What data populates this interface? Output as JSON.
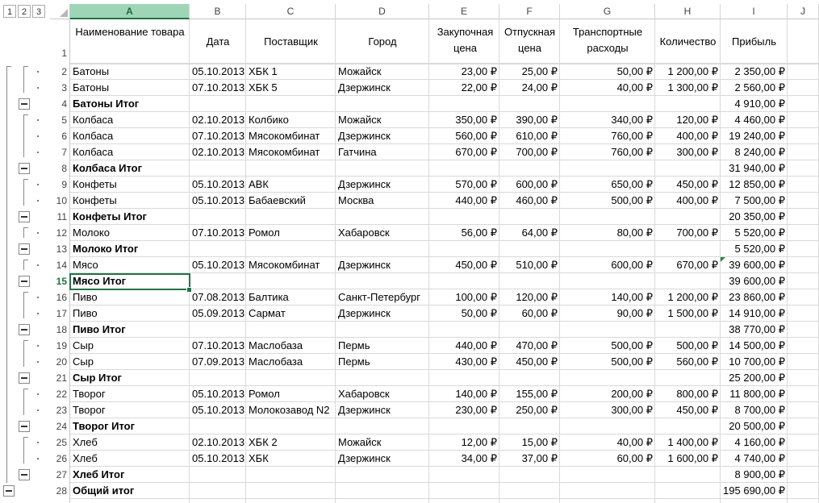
{
  "outline_levels": [
    "1",
    "2",
    "3"
  ],
  "columns": [
    "A",
    "B",
    "C",
    "D",
    "E",
    "F",
    "G",
    "H",
    "I",
    "J"
  ],
  "headers": {
    "name": "Наименование товара",
    "date": "Дата",
    "supplier": "Поставщик",
    "city": "Город",
    "buy_price": "Закупочная цена",
    "sell_price": "Отпускная цена",
    "transport": "Транспортные расходы",
    "qty": "Количество",
    "profit": "Прибыль"
  },
  "rows": [
    {
      "n": "2",
      "name": "Батоны",
      "date": "05.10.2013",
      "supplier": "ХБК 1",
      "city": "Можайск",
      "buy": "23,00 ₽",
      "sell": "25,00 ₽",
      "trans": "50,00 ₽",
      "qty": "1 200,00 ₽",
      "profit": "2 350,00 ₽",
      "type": "detail"
    },
    {
      "n": "3",
      "name": "Батоны",
      "date": "07.10.2013",
      "supplier": "ХБК 5",
      "city": "Дзержинск",
      "buy": "22,00 ₽",
      "sell": "24,00 ₽",
      "trans": "40,00 ₽",
      "qty": "1 300,00 ₽",
      "profit": "2 560,00 ₽",
      "type": "detail"
    },
    {
      "n": "4",
      "name": "Батоны Итог",
      "date": "",
      "supplier": "",
      "city": "",
      "buy": "",
      "sell": "",
      "trans": "",
      "qty": "",
      "profit": "4 910,00 ₽",
      "type": "subtotal"
    },
    {
      "n": "5",
      "name": "Колбаса",
      "date": "02.10.2013",
      "supplier": "Колбико",
      "city": "Можайск",
      "buy": "350,00 ₽",
      "sell": "390,00 ₽",
      "trans": "340,00 ₽",
      "qty": "120,00 ₽",
      "profit": "4 460,00 ₽",
      "type": "detail"
    },
    {
      "n": "6",
      "name": "Колбаса",
      "date": "07.10.2013",
      "supplier": "Мясокомбинат",
      "city": "Дзержинск",
      "buy": "560,00 ₽",
      "sell": "610,00 ₽",
      "trans": "760,00 ₽",
      "qty": "400,00 ₽",
      "profit": "19 240,00 ₽",
      "type": "detail"
    },
    {
      "n": "7",
      "name": "Колбаса",
      "date": "02.10.2013",
      "supplier": "Мясокомбинат",
      "city": "Гатчина",
      "buy": "670,00 ₽",
      "sell": "700,00 ₽",
      "trans": "760,00 ₽",
      "qty": "300,00 ₽",
      "profit": "8 240,00 ₽",
      "type": "detail"
    },
    {
      "n": "8",
      "name": "Колбаса Итог",
      "date": "",
      "supplier": "",
      "city": "",
      "buy": "",
      "sell": "",
      "trans": "",
      "qty": "",
      "profit": "31 940,00 ₽",
      "type": "subtotal"
    },
    {
      "n": "9",
      "name": "Конфеты",
      "date": "05.10.2013",
      "supplier": "АВК",
      "city": "Дзержинск",
      "buy": "570,00 ₽",
      "sell": "600,00 ₽",
      "trans": "650,00 ₽",
      "qty": "450,00 ₽",
      "profit": "12 850,00 ₽",
      "type": "detail"
    },
    {
      "n": "10",
      "name": "Конфеты",
      "date": "05.10.2013",
      "supplier": "Бабаевский",
      "city": "Москва",
      "buy": "440,00 ₽",
      "sell": "460,00 ₽",
      "trans": "500,00 ₽",
      "qty": "400,00 ₽",
      "profit": "7 500,00 ₽",
      "type": "detail"
    },
    {
      "n": "11",
      "name": "Конфеты  Итог",
      "date": "",
      "supplier": "",
      "city": "",
      "buy": "",
      "sell": "",
      "trans": "",
      "qty": "",
      "profit": "20 350,00 ₽",
      "type": "subtotal"
    },
    {
      "n": "12",
      "name": "Молоко",
      "date": "07.10.2013",
      "supplier": "Ромол",
      "city": "Хабаровск",
      "buy": "56,00 ₽",
      "sell": "64,00 ₽",
      "trans": "80,00 ₽",
      "qty": "700,00 ₽",
      "profit": "5 520,00 ₽",
      "type": "detail"
    },
    {
      "n": "13",
      "name": "Молоко Итог",
      "date": "",
      "supplier": "",
      "city": "",
      "buy": "",
      "sell": "",
      "trans": "",
      "qty": "",
      "profit": "5 520,00 ₽",
      "type": "subtotal"
    },
    {
      "n": "14",
      "name": "Мясо",
      "date": "05.10.2013",
      "supplier": "Мясокомбинат",
      "city": "Дзержинск",
      "buy": "450,00 ₽",
      "sell": "510,00 ₽",
      "trans": "600,00 ₽",
      "qty": "670,00 ₽",
      "profit": "39 600,00 ₽",
      "type": "detail"
    },
    {
      "n": "15",
      "name": "Мясо Итог",
      "date": "",
      "supplier": "",
      "city": "",
      "buy": "",
      "sell": "",
      "trans": "",
      "qty": "",
      "profit": "39 600,00 ₽",
      "type": "subtotal"
    },
    {
      "n": "16",
      "name": "Пиво",
      "date": "07.08.2013",
      "supplier": "Балтика",
      "city": "Санкт-Петербург",
      "buy": "100,00 ₽",
      "sell": "120,00 ₽",
      "trans": "140,00 ₽",
      "qty": "1 200,00 ₽",
      "profit": "23 860,00 ₽",
      "type": "detail"
    },
    {
      "n": "17",
      "name": "Пиво",
      "date": "05.09.2013",
      "supplier": "Сармат",
      "city": "Дзержинск",
      "buy": "50,00 ₽",
      "sell": "60,00 ₽",
      "trans": "90,00 ₽",
      "qty": "1 500,00 ₽",
      "profit": "14 910,00 ₽",
      "type": "detail"
    },
    {
      "n": "18",
      "name": "Пиво Итог",
      "date": "",
      "supplier": "",
      "city": "",
      "buy": "",
      "sell": "",
      "trans": "",
      "qty": "",
      "profit": "38 770,00 ₽",
      "type": "subtotal"
    },
    {
      "n": "19",
      "name": "Сыр",
      "date": "07.10.2013",
      "supplier": "Маслобаза",
      "city": "Пермь",
      "buy": "440,00 ₽",
      "sell": "470,00 ₽",
      "trans": "500,00 ₽",
      "qty": "500,00 ₽",
      "profit": "14 500,00 ₽",
      "type": "detail"
    },
    {
      "n": "20",
      "name": "Сыр",
      "date": "07.09.2013",
      "supplier": "Маслобаза",
      "city": "Пермь",
      "buy": "430,00 ₽",
      "sell": "450,00 ₽",
      "trans": "500,00 ₽",
      "qty": "560,00 ₽",
      "profit": "10 700,00 ₽",
      "type": "detail"
    },
    {
      "n": "21",
      "name": "Сыр Итог",
      "date": "",
      "supplier": "",
      "city": "",
      "buy": "",
      "sell": "",
      "trans": "",
      "qty": "",
      "profit": "25 200,00 ₽",
      "type": "subtotal"
    },
    {
      "n": "22",
      "name": "Творог",
      "date": "05.10.2013",
      "supplier": "Ромол",
      "city": "Хабаровск",
      "buy": "140,00 ₽",
      "sell": "155,00 ₽",
      "trans": "200,00 ₽",
      "qty": "800,00 ₽",
      "profit": "11 800,00 ₽",
      "type": "detail"
    },
    {
      "n": "23",
      "name": "Творог",
      "date": "05.10.2013",
      "supplier": "Молокозавод N2",
      "city": "Дзержинск",
      "buy": "230,00 ₽",
      "sell": "250,00 ₽",
      "trans": "300,00 ₽",
      "qty": "450,00 ₽",
      "profit": "8 700,00 ₽",
      "type": "detail"
    },
    {
      "n": "24",
      "name": "Творог Итог",
      "date": "",
      "supplier": "",
      "city": "",
      "buy": "",
      "sell": "",
      "trans": "",
      "qty": "",
      "profit": "20 500,00 ₽",
      "type": "subtotal"
    },
    {
      "n": "25",
      "name": "Хлеб",
      "date": "02.10.2013",
      "supplier": "ХБК 2",
      "city": "Можайск",
      "buy": "12,00 ₽",
      "sell": "15,00 ₽",
      "trans": "40,00 ₽",
      "qty": "1 400,00 ₽",
      "profit": "4 160,00 ₽",
      "type": "detail"
    },
    {
      "n": "26",
      "name": "Хлеб",
      "date": "05.10.2013",
      "supplier": "ХБК",
      "city": "Дзержинск",
      "buy": "34,00 ₽",
      "sell": "37,00 ₽",
      "trans": "60,00 ₽",
      "qty": "1 600,00 ₽",
      "profit": "4 740,00 ₽",
      "type": "detail"
    },
    {
      "n": "27",
      "name": "Хлеб Итог",
      "date": "",
      "supplier": "",
      "city": "",
      "buy": "",
      "sell": "",
      "trans": "",
      "qty": "",
      "profit": "8 900,00 ₽",
      "type": "subtotal"
    },
    {
      "n": "28",
      "name": "Общий итог",
      "date": "",
      "supplier": "",
      "city": "",
      "buy": "",
      "sell": "",
      "trans": "",
      "qty": "",
      "profit": "195 690,00 ₽",
      "type": "grandtotal"
    }
  ],
  "selected_cell_row": "15",
  "header_row_number": "1",
  "colors": {
    "accent": "#217346",
    "selected_header": "#9fd5b7",
    "grid": "#d9d9d9"
  }
}
